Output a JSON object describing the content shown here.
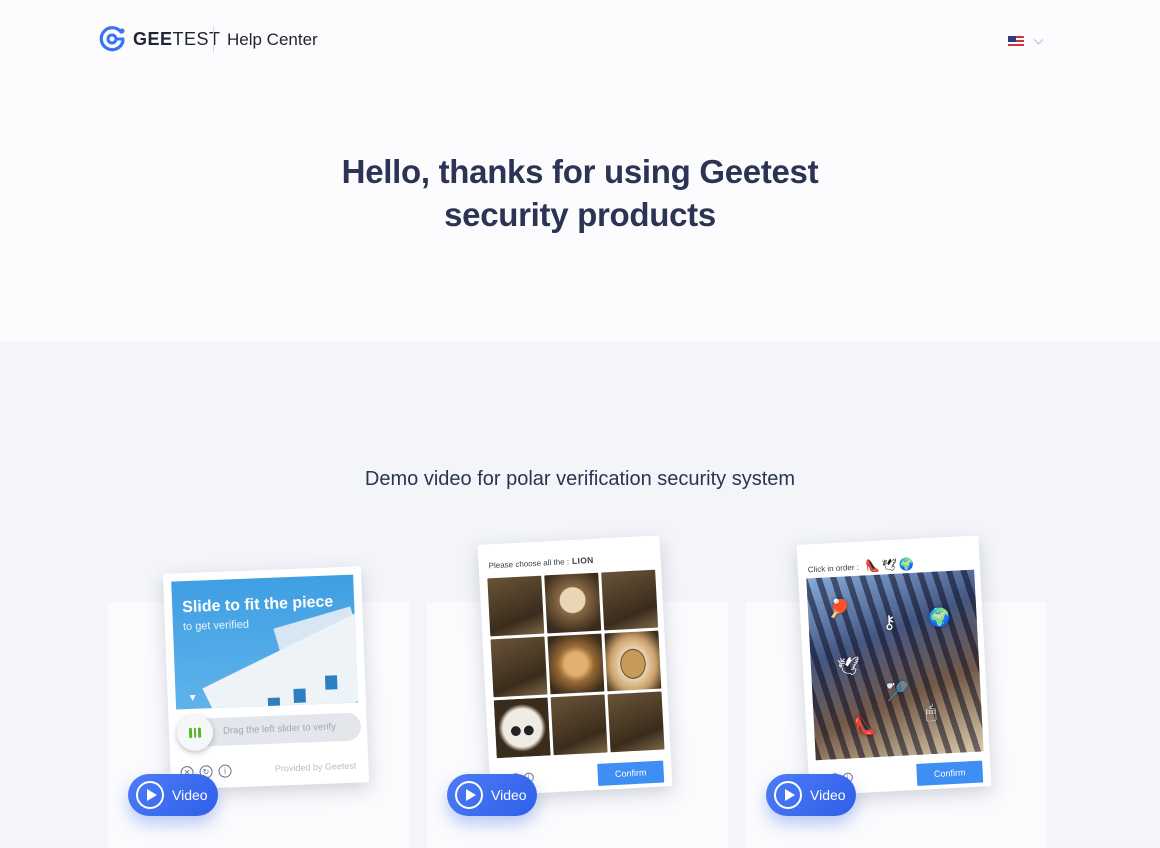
{
  "header": {
    "brand_bold": "GEE",
    "brand_light": "TEST",
    "help_center": "Help Center",
    "language_flag": "us-flag-icon"
  },
  "hero": {
    "title_line1": "Hello, thanks for using Geetest",
    "title_line2": "security products"
  },
  "demo": {
    "section_title": "Demo video for polar verification security system",
    "video_label": "Video",
    "cards": [
      {
        "type": "slide",
        "title": "Slide to fit the piece",
        "subtitle": "to get verified",
        "slider_hint": "Drag the left slider to verify",
        "provided_by": "Provided by Geetest"
      },
      {
        "type": "click",
        "question": "Please choose all the :",
        "target": "LION",
        "confirm": "Confirm"
      },
      {
        "type": "order",
        "question": "Click in order :",
        "order_icons": "👠🕊🌍",
        "confirm": "Confirm"
      }
    ]
  },
  "footer_icons": [
    "close-icon",
    "refresh-icon",
    "info-icon"
  ],
  "colors": {
    "accent": "#2f5fe8",
    "confirm": "#3e8ef3",
    "text": "#2c3454",
    "section_bg": "#f3f5f9"
  }
}
